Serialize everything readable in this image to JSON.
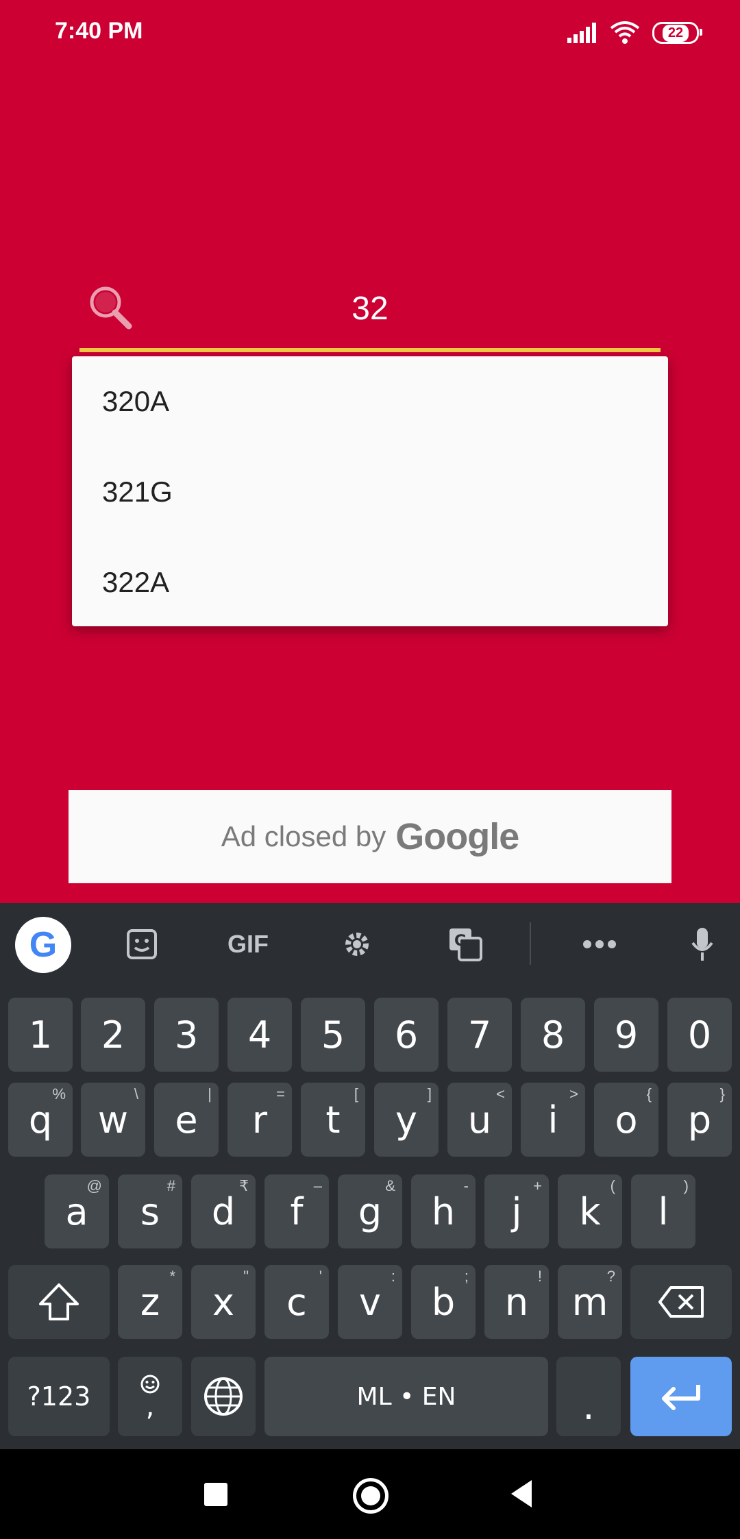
{
  "status_bar": {
    "time": "7:40 PM",
    "battery": "22"
  },
  "search": {
    "value": "32"
  },
  "suggestions": [
    "320A",
    "321G",
    "322A"
  ],
  "ad": {
    "text": "Ad closed by",
    "brand": "Google"
  },
  "keyboard": {
    "toolbar": {
      "gif_label": "GIF"
    },
    "number_row": [
      "1",
      "2",
      "3",
      "4",
      "5",
      "6",
      "7",
      "8",
      "9",
      "0"
    ],
    "row1": [
      {
        "key": "q",
        "hint": "%"
      },
      {
        "key": "w",
        "hint": "\\"
      },
      {
        "key": "e",
        "hint": "|"
      },
      {
        "key": "r",
        "hint": "="
      },
      {
        "key": "t",
        "hint": "["
      },
      {
        "key": "y",
        "hint": "]"
      },
      {
        "key": "u",
        "hint": "<"
      },
      {
        "key": "i",
        "hint": ">"
      },
      {
        "key": "o",
        "hint": "{"
      },
      {
        "key": "p",
        "hint": "}"
      }
    ],
    "row2": [
      {
        "key": "a",
        "hint": "@"
      },
      {
        "key": "s",
        "hint": "#"
      },
      {
        "key": "d",
        "hint": "₹"
      },
      {
        "key": "f",
        "hint": "–"
      },
      {
        "key": "g",
        "hint": "&"
      },
      {
        "key": "h",
        "hint": "-"
      },
      {
        "key": "j",
        "hint": "+"
      },
      {
        "key": "k",
        "hint": "("
      },
      {
        "key": "l",
        "hint": ")"
      }
    ],
    "row3": [
      {
        "key": "z",
        "hint": "*"
      },
      {
        "key": "x",
        "hint": "\""
      },
      {
        "key": "c",
        "hint": "'"
      },
      {
        "key": "v",
        "hint": ":"
      },
      {
        "key": "b",
        "hint": ";"
      },
      {
        "key": "n",
        "hint": "!"
      },
      {
        "key": "m",
        "hint": "?"
      }
    ],
    "symbols_label": "?123",
    "comma_label": ",",
    "space_label": "ML • EN",
    "period_label": "."
  },
  "colors": {
    "background": "#cc0033",
    "underline": "#f6c945",
    "enter": "#5f9cf0"
  }
}
